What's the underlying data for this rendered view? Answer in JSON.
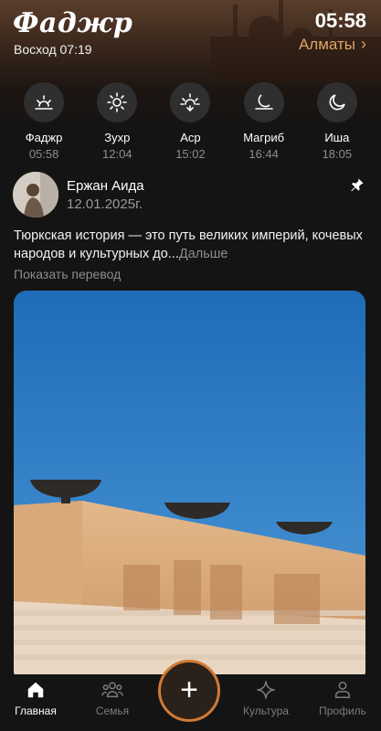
{
  "header": {
    "prayer_name": "Фаджр",
    "sunrise": "Восход 07:19",
    "time": "05:58",
    "city": "Алматы",
    "city_icon": "chevron-right-icon"
  },
  "prayers": [
    {
      "name": "Фаджр",
      "time": "05:58",
      "icon": "sunrise-icon"
    },
    {
      "name": "Зухр",
      "time": "12:04",
      "icon": "sun-icon"
    },
    {
      "name": "Аср",
      "time": "15:02",
      "icon": "sun-down-icon"
    },
    {
      "name": "Магриб",
      "time": "16:44",
      "icon": "sunset-moon-icon"
    },
    {
      "name": "Иша",
      "time": "18:05",
      "icon": "moon-icon"
    }
  ],
  "post": {
    "author": "Ержан Аида",
    "date": "12.01.2025г.",
    "text": "Тюркская история — это путь великих империй, кочевых народов и культурных до...",
    "more": "Дальше",
    "translate": "Показать перевод"
  },
  "nav": {
    "home": "Главная",
    "family": "Семья",
    "add": "+",
    "culture": "Культура",
    "profile": "Профиль"
  },
  "colors": {
    "accent": "#e0a464",
    "fab_border": "#d07a35",
    "background": "#141414"
  }
}
